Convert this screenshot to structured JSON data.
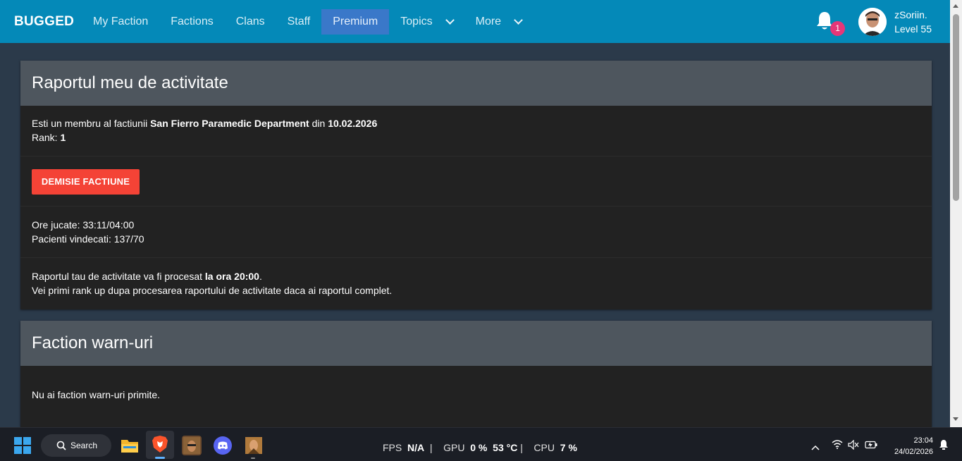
{
  "navbar": {
    "brand": "BUGGED",
    "items": [
      {
        "label": "My Faction"
      },
      {
        "label": "Factions"
      },
      {
        "label": "Clans"
      },
      {
        "label": "Staff"
      },
      {
        "label": "Premium"
      },
      {
        "label": "Topics"
      },
      {
        "label": "More"
      }
    ],
    "notification_count": "1",
    "user": {
      "name": "zSoriin.",
      "level": "Level 55"
    },
    "colors": {
      "bar": "#0489b8",
      "active": "#3a78c9",
      "badge": "#e53678"
    }
  },
  "activity_card": {
    "title": "Raportul meu de activitate",
    "membership_prefix": "Esti un membru al factiunii ",
    "faction_name": "San Fierro Paramedic Department",
    "membership_mid": " din ",
    "join_date": "10.02.2026",
    "rank_label": "Rank: ",
    "rank_value": "1",
    "resign_button": "DEMISIE FACTIUNE",
    "hours_played": "Ore jucate: 33:11/04:00",
    "patients_healed": "Pacienti vindecati: 137/70",
    "report_prefix": "Raportul tau de activitate va fi procesat ",
    "report_time": "la ora 20:00",
    "report_suffix": ".",
    "rankup_note": "Vei primi rank up dupa procesarea raportului de activitate daca ai raportul complet."
  },
  "warn_card": {
    "title": "Faction warn-uri",
    "empty_message": "Nu ai faction warn-uri primite."
  },
  "taskbar": {
    "search_label": "Search",
    "fps_label": "FPS",
    "fps_value": "N/A",
    "gpu_label": "GPU",
    "gpu_value": "0 %",
    "gpu_temp": "53 °C",
    "cpu_label": "CPU",
    "cpu_value": "7 %",
    "time": "23:04",
    "date": "24/02/2026"
  }
}
